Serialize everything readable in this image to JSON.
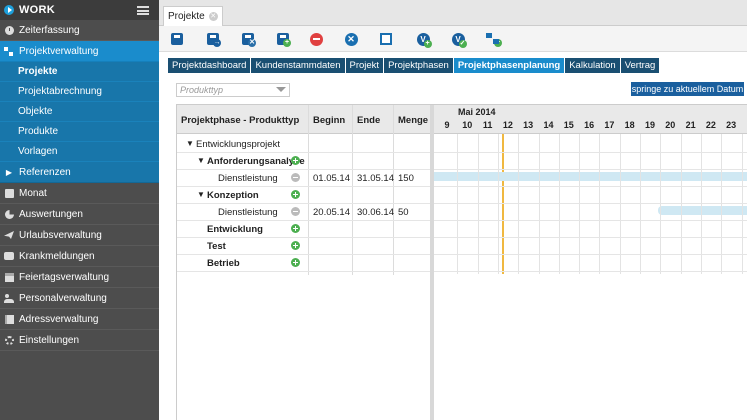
{
  "app": {
    "name": "WORK"
  },
  "sidebar": {
    "items": [
      {
        "label": "Zeiterfassung",
        "icon": "clock-icon"
      },
      {
        "label": "Projektverwaltung",
        "icon": "hierarchy-icon"
      },
      {
        "label": "Monat",
        "icon": "box-icon"
      },
      {
        "label": "Auswertungen",
        "icon": "pie-chart-icon"
      },
      {
        "label": "Urlaubsverwaltung",
        "icon": "plane-icon"
      },
      {
        "label": "Krankmeldungen",
        "icon": "medical-icon"
      },
      {
        "label": "Feiertagsverwaltung",
        "icon": "calendar-icon"
      },
      {
        "label": "Personalverwaltung",
        "icon": "people-icon"
      },
      {
        "label": "Adressverwaltung",
        "icon": "address-book-icon"
      },
      {
        "label": "Einstellungen",
        "icon": "gear-icon"
      }
    ],
    "sub_items": [
      "Projekte",
      "Projektabrechnung",
      "Objekte",
      "Produkte",
      "Vorlagen"
    ],
    "references": "Referenzen"
  },
  "tab": {
    "label": "Projekte"
  },
  "subtabs": [
    "Projektdashboard",
    "Kundenstammdaten",
    "Projekt",
    "Projektphasen",
    "Projektphasenplanung",
    "Kalkulation",
    "Vertrag"
  ],
  "filter": {
    "placeholder": "Produkttyp"
  },
  "jump_button": "springe zu aktuellem Datum",
  "table": {
    "headers": [
      "Projektphase - Produkttyp",
      "Beginn",
      "Ende",
      "Menge"
    ],
    "rows": [
      {
        "label": "Entwicklungsprojekt",
        "begin": "",
        "end": "",
        "qty": ""
      },
      {
        "label": "Anforderungsanalyse",
        "begin": "",
        "end": "",
        "qty": ""
      },
      {
        "label": "Dienstleistung",
        "begin": "01.05.14",
        "end": "31.05.14",
        "qty": "150"
      },
      {
        "label": "Konzeption",
        "begin": "",
        "end": "",
        "qty": ""
      },
      {
        "label": "Dienstleistung",
        "begin": "20.05.14",
        "end": "30.06.14",
        "qty": "50"
      },
      {
        "label": "Entwicklung",
        "begin": "",
        "end": "",
        "qty": ""
      },
      {
        "label": "Test",
        "begin": "",
        "end": "",
        "qty": ""
      },
      {
        "label": "Betrieb",
        "begin": "",
        "end": "",
        "qty": ""
      }
    ]
  },
  "gantt": {
    "month": "Mai 2014",
    "days": [
      "9",
      "10",
      "11",
      "12",
      "13",
      "14",
      "15",
      "16",
      "17",
      "18",
      "19",
      "20",
      "21",
      "22",
      "23"
    ]
  }
}
